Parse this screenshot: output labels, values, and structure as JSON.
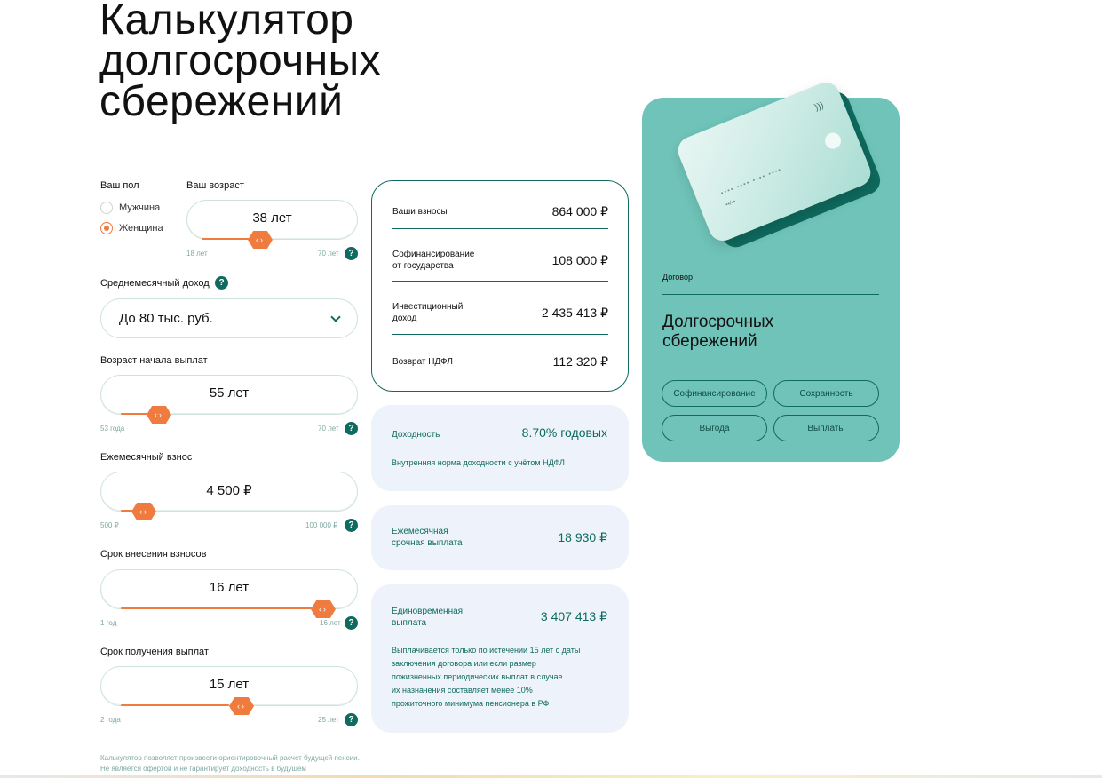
{
  "page": {
    "title": "Калькулятор\nдолгосрочных\nсбережений"
  },
  "gender": {
    "label": "Ваш пол",
    "options": [
      "Мужчина",
      "Женщина"
    ],
    "selected": "Женщина"
  },
  "age": {
    "label": "Ваш возраст",
    "value": "38 лет",
    "min_label": "18 лет",
    "max_label": "70 лет",
    "level": 0.38
  },
  "income": {
    "label": "Среднемесячный доход",
    "selected": "До 80 тыс. руб."
  },
  "payout_start": {
    "label": "Возраст начала выплат",
    "value": "55 лет",
    "min_label": "53 года",
    "max_label": "70 лет",
    "level": 0.12
  },
  "monthly_contribution": {
    "label": "Ежемесячный взнос",
    "value": "4 500 ₽",
    "min_label": "500 ₽",
    "max_label": "100 000 ₽",
    "level": 0.04
  },
  "contribution_term": {
    "label": "Срок внесения взносов",
    "value": "16 лет",
    "min_label": "1 год",
    "max_label": "16 лет",
    "level": 1.0
  },
  "payout_term": {
    "label": "Срок получения выплат",
    "value": "15 лет",
    "min_label": "2 года",
    "max_label": "25 лет",
    "level": 0.57
  },
  "results": {
    "contributions": {
      "label": "Ваши взносы",
      "value": "864 000 ₽"
    },
    "cofinancing": {
      "label": "Софинансирование\nот государства",
      "value": "108 000 ₽"
    },
    "investment": {
      "label": "Инвестиционный\nдоход",
      "value": "2 435 413 ₽"
    },
    "tax_refund": {
      "label": "Возврат НДФЛ",
      "value": "112 320 ₽"
    }
  },
  "yield": {
    "label": "Доходность",
    "value": "8.70% годовых",
    "description": "Внутренняя норма доходности с учётом НДФЛ"
  },
  "monthly_payout": {
    "label": "Ежемесячная\nсрочная выплата",
    "value": "18 930 ₽"
  },
  "lump_sum": {
    "label": "Единовременная\nвыплата",
    "value": "3 407 413 ₽",
    "description": "Выплачивается только по истечении 15 лет с даты\nзаключения договора или если размер\nпожизненных периодических выплат в случае\nих назначения составляет менее 10%\nпрожиточного минимума пенсионера в РФ"
  },
  "promo": {
    "category": "Договор",
    "name": "Долгосрочных\nсбережений",
    "tags": [
      "Софинансирование",
      "Сохранность",
      "Выгода",
      "Выплаты"
    ],
    "card_number": "•••• •••• •••• ••••",
    "card_expiry": "••/••"
  },
  "footer": {
    "disclaimer": "Калькулятор позволяет произвести ориентировочный расчет будущей пенсии.\nНе является офертой и не гарантирует доходность в будущем"
  },
  "colors": {
    "accent": "#f07b3f",
    "primary": "#0f6b5f",
    "promo_bg": "#6fc3b8",
    "soft_bg": "#eef3fb"
  }
}
